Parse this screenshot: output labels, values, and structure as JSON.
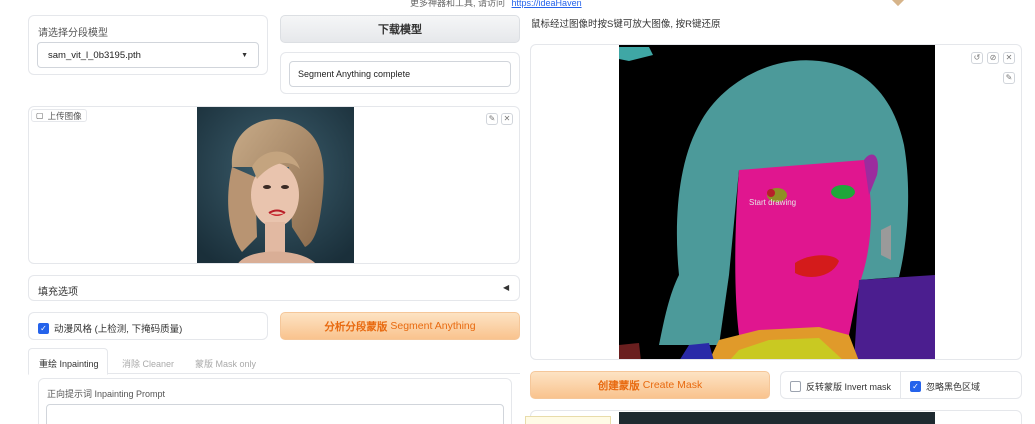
{
  "top_banner": {
    "text": "更多神器和工具, 请访问",
    "link": "https://ideaHaven"
  },
  "segment_model": {
    "label": "请选择分段模型",
    "selected": "sam_vit_l_0b3195.pth"
  },
  "download_button": {
    "label": "下载模型"
  },
  "status_box": {
    "value": "Segment Anything complete"
  },
  "upload_image": {
    "tag_label": "上传图像"
  },
  "fill_options": {
    "label": "填充选项"
  },
  "anime_style": {
    "label": "动漫风格 (上检测, 下掩码质量)",
    "checked": true
  },
  "analyze_button": {
    "zh": "分析分段蒙版",
    "en": "Segment Anything"
  },
  "tabs": [
    {
      "label": "重绘 Inpainting",
      "active": true
    },
    {
      "label": "消除 Cleaner",
      "active": false
    },
    {
      "label": "蒙版 Mask only",
      "active": false
    }
  ],
  "prompt": {
    "label": "正向提示词 Inpainting Prompt",
    "value": ""
  },
  "right_hint": "鼠标经过图像时按S键可放大图像, 按R键还原",
  "canvas": {
    "overlay_text": "Start drawing"
  },
  "create_mask_button": {
    "zh": "创建蒙版",
    "en": "Create Mask"
  },
  "invert_mask": {
    "label": "反转蒙版 Invert mask",
    "checked": false
  },
  "ignore_black": {
    "label": "忽略黑色区域",
    "checked": true
  },
  "colors": {
    "accent_orange": "#e86a10",
    "checkbox_blue": "#2563eb",
    "seg_teal": "#4c9a9a",
    "seg_magenta": "#e0168f"
  }
}
